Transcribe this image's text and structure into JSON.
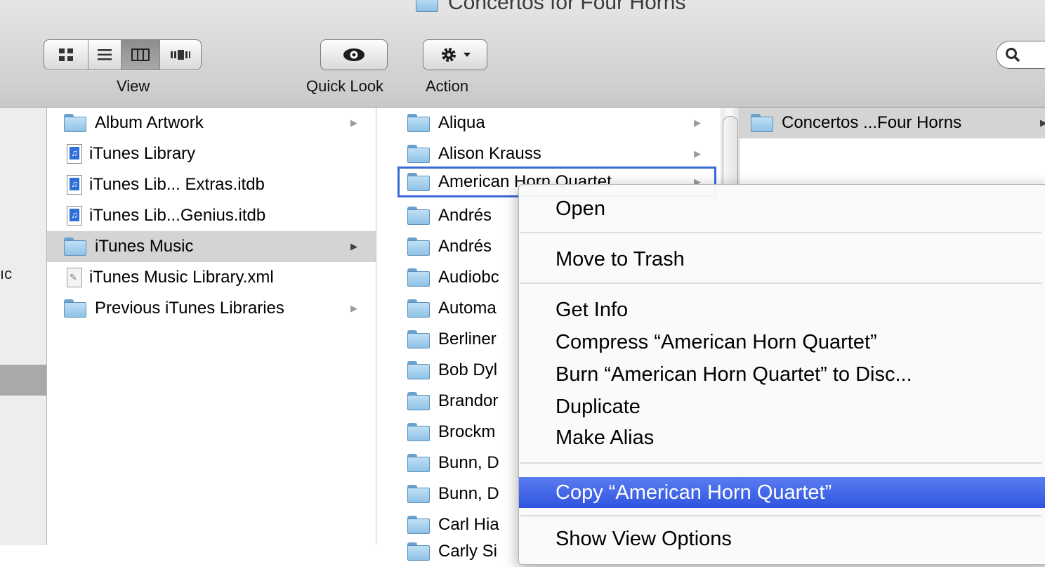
{
  "window": {
    "title": "Concertos for Four Horns"
  },
  "toolbar": {
    "view_label": "View",
    "quicklook_label": "Quick Look",
    "action_label": "Action",
    "view_modes": [
      "icon-view",
      "list-view",
      "column-view",
      "coverflow-view"
    ],
    "active_view": "column-view"
  },
  "sidebar": {
    "fragment": "ıc"
  },
  "column1": {
    "items": [
      {
        "label": "Album Artwork",
        "icon": "folder-icon",
        "arrow": "▶"
      },
      {
        "label": "iTunes Library",
        "icon": "itunes-doc-icon",
        "arrow": ""
      },
      {
        "label": "iTunes Lib... Extras.itdb",
        "icon": "itunes-doc-icon",
        "arrow": ""
      },
      {
        "label": "iTunes Lib...Genius.itdb",
        "icon": "itunes-doc-icon",
        "arrow": ""
      },
      {
        "label": "iTunes Music",
        "icon": "folder-icon",
        "arrow": "▶"
      },
      {
        "label": "iTunes Music Library.xml",
        "icon": "xml-doc-icon",
        "arrow": ""
      },
      {
        "label": "Previous iTunes Libraries",
        "icon": "folder-icon",
        "arrow": "▶"
      }
    ]
  },
  "column2": {
    "items": [
      {
        "label": "Aliqua",
        "arrow": "▶"
      },
      {
        "label": "Alison Krauss",
        "arrow": "▶"
      },
      {
        "label": "American Horn Quartet",
        "arrow": "▶"
      },
      {
        "label": "Andrés",
        "arrow": ""
      },
      {
        "label": "Andrés",
        "arrow": ""
      },
      {
        "label": "Audiobc",
        "arrow": ""
      },
      {
        "label": "Automa",
        "arrow": ""
      },
      {
        "label": "Berliner",
        "arrow": ""
      },
      {
        "label": "Bob Dyl",
        "arrow": ""
      },
      {
        "label": "Brandor",
        "arrow": ""
      },
      {
        "label": "Brockm",
        "arrow": ""
      },
      {
        "label": "Bunn, D",
        "arrow": ""
      },
      {
        "label": "Bunn, D",
        "arrow": ""
      },
      {
        "label": "Carl Hia",
        "arrow": ""
      },
      {
        "label": "Carly Si",
        "arrow": ""
      }
    ]
  },
  "column3": {
    "items": [
      {
        "label": "Concertos ...Four Horns",
        "arrow": "▶"
      }
    ]
  },
  "context_menu": {
    "open": "Open",
    "move_to_trash": "Move to Trash",
    "get_info": "Get Info",
    "compress": "Compress “American Horn Quartet”",
    "burn": "Burn “American Horn Quartet” to Disc...",
    "duplicate": "Duplicate",
    "make_alias": "Make Alias",
    "copy": "Copy “American Horn Quartet”",
    "show_view_options": "Show View Options"
  },
  "colors": {
    "highlight": "#3a5fe6",
    "selection_gray": "#d4d4d4",
    "focus_ring": "#3a69d6"
  }
}
